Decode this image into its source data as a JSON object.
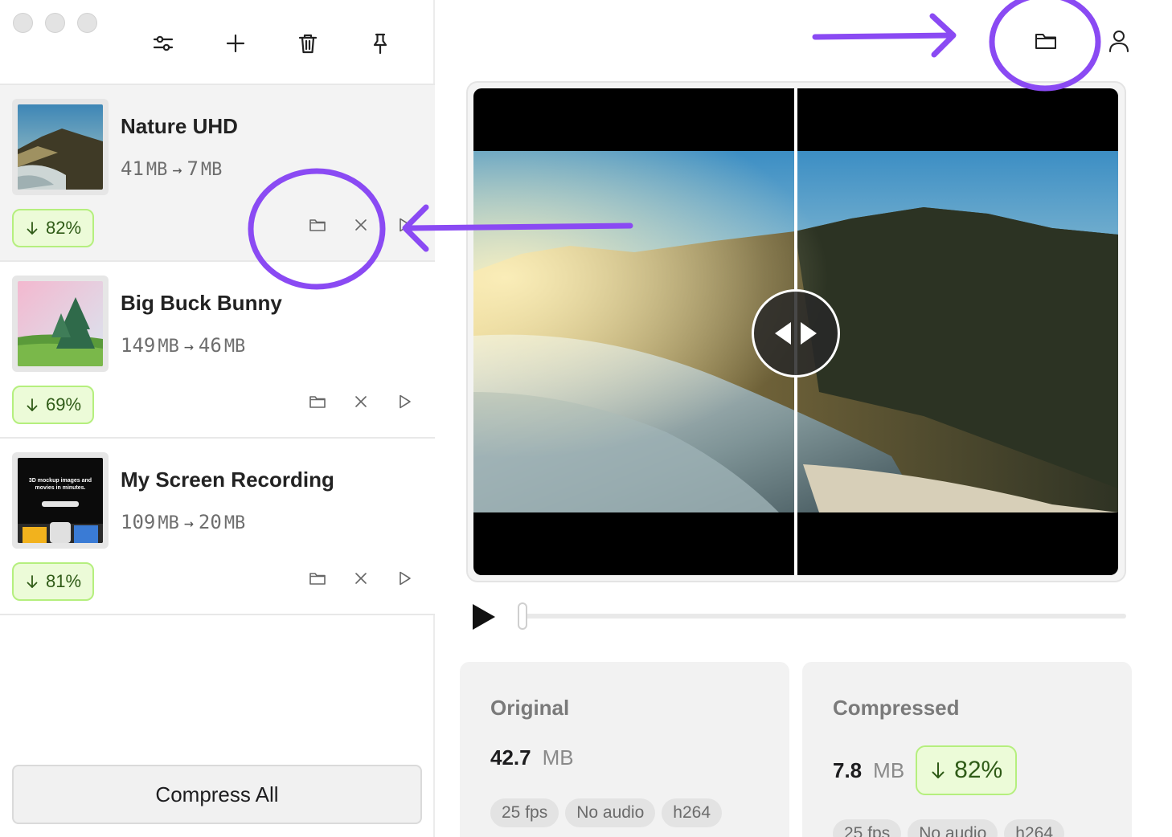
{
  "sidebar": {
    "items": [
      {
        "title": "Nature UHD",
        "orig_num": "41",
        "orig_unit": "MB",
        "comp_num": "7",
        "comp_unit": "MB",
        "reduction": "82%",
        "selected": true
      },
      {
        "title": "Big Buck Bunny",
        "orig_num": "149",
        "orig_unit": "MB",
        "comp_num": "46",
        "comp_unit": "MB",
        "reduction": "69%",
        "selected": false
      },
      {
        "title": "My Screen Recording",
        "orig_num": "109",
        "orig_unit": "MB",
        "comp_num": "20",
        "comp_unit": "MB",
        "reduction": "81%",
        "selected": false
      }
    ],
    "compress_all_label": "Compress All",
    "screen_thumb_text": "3D mockup images and movies in minutes."
  },
  "player": {
    "progress": 0.0
  },
  "stats": {
    "original": {
      "title": "Original",
      "size": "42.7",
      "unit": "MB",
      "chips": [
        "25 fps",
        "No audio",
        "h264"
      ]
    },
    "compressed": {
      "title": "Compressed",
      "size": "7.8",
      "unit": "MB",
      "reduction": "82%",
      "chips": [
        "25 fps",
        "No audio",
        "h264"
      ]
    }
  },
  "colors": {
    "accent_annotation": "#8a4af3",
    "badge_bg": "#ecfbd8",
    "badge_border": "#b5ef7e",
    "badge_text": "#2f5b17"
  }
}
